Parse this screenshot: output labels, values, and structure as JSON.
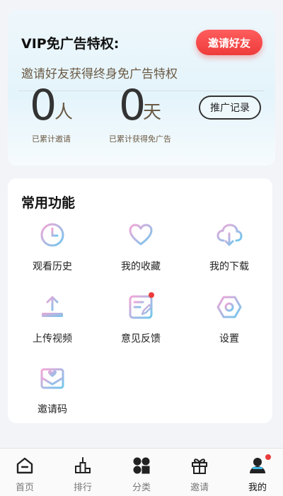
{
  "vip": {
    "title": "VIP免广告特权:",
    "invite_button": "邀请好友",
    "subtitle": "邀请好友获得终身免广告特权",
    "invited_count": "0",
    "invited_unit": "人",
    "invited_label": "已累计邀请",
    "days_count": "0",
    "days_unit": "天",
    "days_label": "已累计获得免广告",
    "record_button": "推广记录"
  },
  "functions": {
    "title": "常用功能",
    "items": [
      {
        "label": "观看历史",
        "icon": "clock-icon"
      },
      {
        "label": "我的收藏",
        "icon": "heart-icon"
      },
      {
        "label": "我的下载",
        "icon": "cloud-download-icon"
      },
      {
        "label": "上传视频",
        "icon": "upload-icon"
      },
      {
        "label": "意见反馈",
        "icon": "feedback-edit-icon",
        "badge": true
      },
      {
        "label": "设置",
        "icon": "settings-hexagon-icon"
      },
      {
        "label": "邀请码",
        "icon": "envelope-heart-icon"
      }
    ]
  },
  "tabs": [
    {
      "label": "首页",
      "icon": "home-icon"
    },
    {
      "label": "排行",
      "icon": "ranking-icon"
    },
    {
      "label": "分类",
      "icon": "category-icon"
    },
    {
      "label": "邀请",
      "icon": "gift-icon"
    },
    {
      "label": "我的",
      "icon": "profile-icon",
      "active": true,
      "badge": true
    }
  ],
  "colors": {
    "accent_red": "#ee3b3b",
    "gradient_blue": "#6fc7ee",
    "gradient_pink": "#f3a6d6"
  }
}
